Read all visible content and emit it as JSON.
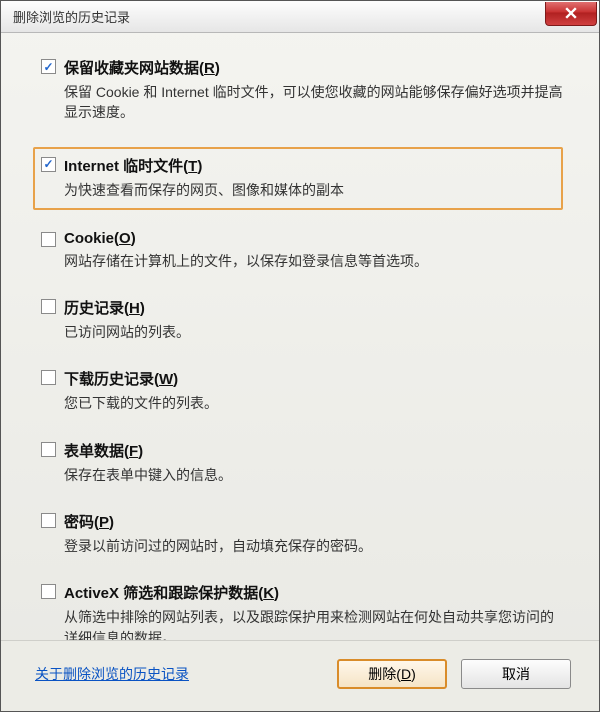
{
  "window": {
    "title": "删除浏览的历史记录"
  },
  "options": {
    "favorites": {
      "checked": true,
      "highlight": false,
      "label_pre": "保留收藏夹网站数据(",
      "hotkey": "R",
      "label_post": ")",
      "desc": "保留 Cookie 和 Internet 临时文件，可以使您收藏的网站能够保存偏好选项并提高显示速度。"
    },
    "tempfiles": {
      "checked": true,
      "highlight": true,
      "label_pre": "Internet 临时文件(",
      "hotkey": "T",
      "label_post": ")",
      "desc": "为快速查看而保存的网页、图像和媒体的副本"
    },
    "cookie": {
      "checked": false,
      "highlight": false,
      "label_pre": "Cookie(",
      "hotkey": "O",
      "label_post": ")",
      "desc": "网站存储在计算机上的文件，以保存如登录信息等首选项。"
    },
    "history": {
      "checked": false,
      "highlight": false,
      "label_pre": "历史记录(",
      "hotkey": "H",
      "label_post": ")",
      "desc": "已访问网站的列表。"
    },
    "download": {
      "checked": false,
      "highlight": false,
      "label_pre": "下载历史记录(",
      "hotkey": "W",
      "label_post": ")",
      "desc": "您已下载的文件的列表。"
    },
    "formdata": {
      "checked": false,
      "highlight": false,
      "label_pre": "表单数据(",
      "hotkey": "F",
      "label_post": ")",
      "desc": "保存在表单中键入的信息。"
    },
    "password": {
      "checked": false,
      "highlight": false,
      "label_pre": "密码(",
      "hotkey": "P",
      "label_post": ")",
      "desc": "登录以前访问过的网站时，自动填充保存的密码。"
    },
    "activex": {
      "checked": false,
      "highlight": false,
      "label_pre": "ActiveX 筛选和跟踪保护数据(",
      "hotkey": "K",
      "label_post": ")",
      "desc": "从筛选中排除的网站列表，以及跟踪保护用来检测网站在何处自动共享您访问的详细信息的数据。"
    }
  },
  "footer": {
    "help_link": "关于删除浏览的历史记录",
    "delete_pre": "删除(",
    "delete_hotkey": "D",
    "delete_post": ")",
    "cancel": "取消"
  }
}
